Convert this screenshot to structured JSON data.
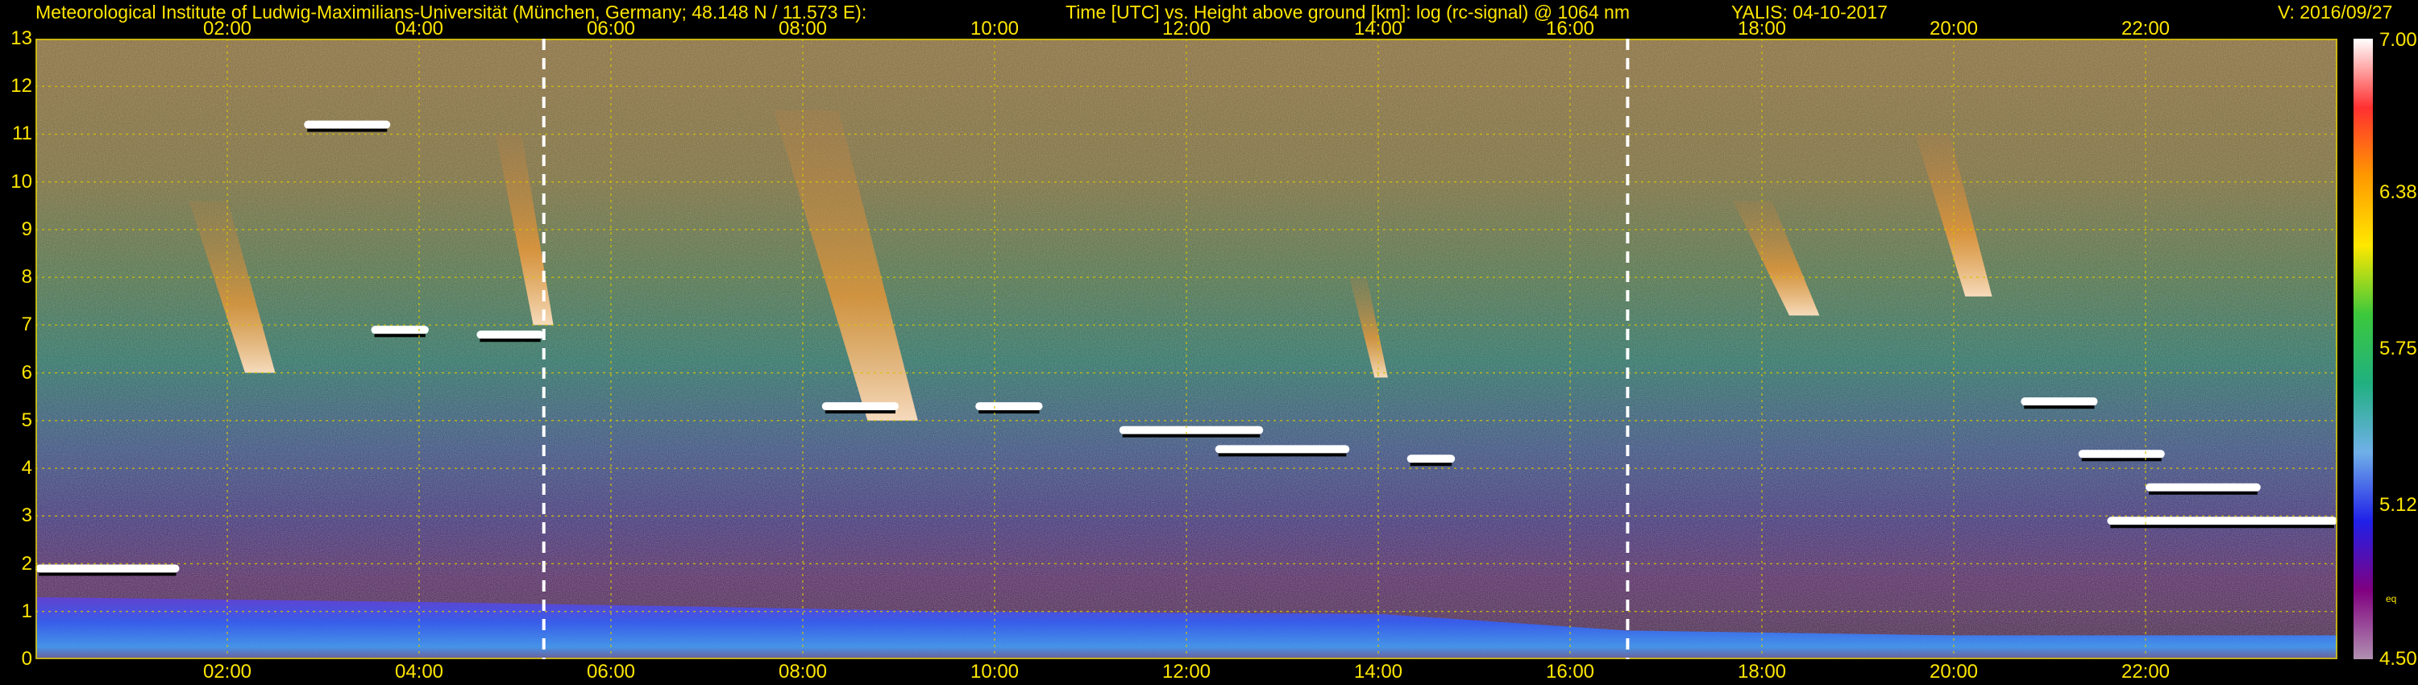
{
  "header": {
    "institute": "Meteorological Institute of Ludwig-Maximilians-Universität (München, Germany; 48.148 N / 11.573 E):",
    "plot_title": "Time [UTC] vs. Height above ground [km]: log (rc-signal) @ 1064 nm",
    "instrument": "YALIS: 04-10-2017",
    "version": "V: 2016/09/27"
  },
  "chart_data": {
    "type": "heatmap",
    "title": "Time [UTC] vs. Height above ground [km]: log (rc-signal) @ 1064 nm",
    "x_range": [
      "00:00",
      "24:00"
    ],
    "y_range": [
      0,
      13
    ],
    "y_ticks": [
      "0",
      "1",
      "2",
      "3",
      "4",
      "5",
      "6",
      "7",
      "8",
      "9",
      "10",
      "11",
      "12",
      "13"
    ],
    "x_ticks": [
      {
        "label": "02:00",
        "hour": 2
      },
      {
        "label": "04:00",
        "hour": 4
      },
      {
        "label": "06:00",
        "hour": 6
      },
      {
        "label": "08:00",
        "hour": 8
      },
      {
        "label": "10:00",
        "hour": 10
      },
      {
        "label": "12:00",
        "hour": 12
      },
      {
        "label": "14:00",
        "hour": 14
      },
      {
        "label": "16:00",
        "hour": 16
      },
      {
        "label": "18:00",
        "hour": 18
      },
      {
        "label": "20:00",
        "hour": 20
      },
      {
        "label": "22:00",
        "hour": 22
      }
    ],
    "grid": true,
    "vertical_markers_hour": [
      5.3,
      16.6
    ],
    "colorbar": {
      "min": 4.5,
      "max": 7.0,
      "tick_labels": [
        "7.00",
        "6.38",
        "5.75",
        "5.12",
        "4.50"
      ],
      "tick_values": [
        7.0,
        6.38,
        5.75,
        5.12,
        4.5
      ],
      "unit_label": "eq"
    },
    "features": {
      "cloud_segments": [
        {
          "start_hour": 0.0,
          "end_hour": 1.5,
          "height_km": 1.9
        },
        {
          "start_hour": 2.8,
          "end_hour": 3.7,
          "height_km": 11.2
        },
        {
          "start_hour": 3.5,
          "end_hour": 4.1,
          "height_km": 6.9
        },
        {
          "start_hour": 4.6,
          "end_hour": 5.3,
          "height_km": 6.8
        },
        {
          "start_hour": 8.2,
          "end_hour": 9.0,
          "height_km": 5.3
        },
        {
          "start_hour": 9.8,
          "end_hour": 10.5,
          "height_km": 5.3
        },
        {
          "start_hour": 11.3,
          "end_hour": 12.8,
          "height_km": 4.8
        },
        {
          "start_hour": 12.3,
          "end_hour": 13.7,
          "height_km": 4.4
        },
        {
          "start_hour": 14.3,
          "end_hour": 14.8,
          "height_km": 4.2
        },
        {
          "start_hour": 20.7,
          "end_hour": 21.5,
          "height_km": 5.4
        },
        {
          "start_hour": 21.3,
          "end_hour": 22.2,
          "height_km": 4.3
        },
        {
          "start_hour": 22.0,
          "end_hour": 23.2,
          "height_km": 3.6
        },
        {
          "start_hour": 21.6,
          "end_hour": 24.0,
          "height_km": 2.9
        }
      ],
      "virga_streaks": [
        {
          "start_hour": 1.6,
          "end_hour": 2.5,
          "top_km": 9.6,
          "bottom_km": 6.0
        },
        {
          "start_hour": 4.8,
          "end_hour": 5.4,
          "top_km": 11.0,
          "bottom_km": 7.0
        },
        {
          "start_hour": 7.7,
          "end_hour": 9.2,
          "top_km": 11.5,
          "bottom_km": 5.0
        },
        {
          "start_hour": 13.7,
          "end_hour": 14.1,
          "top_km": 8.0,
          "bottom_km": 5.9
        },
        {
          "start_hour": 17.7,
          "end_hour": 18.6,
          "top_km": 9.6,
          "bottom_km": 7.2
        },
        {
          "start_hour": 19.6,
          "end_hour": 20.4,
          "top_km": 11.0,
          "bottom_km": 7.6
        }
      ],
      "boundary_layer_top_km": [
        {
          "hour": 0,
          "km": 1.3
        },
        {
          "hour": 4,
          "km": 1.2
        },
        {
          "hour": 7,
          "km": 1.1
        },
        {
          "hour": 9.5,
          "km": 1.0
        },
        {
          "hour": 14,
          "km": 0.95
        },
        {
          "hour": 16.6,
          "km": 0.6
        },
        {
          "hour": 20,
          "km": 0.5
        },
        {
          "hour": 24,
          "km": 0.5
        }
      ]
    }
  },
  "colors": {
    "text": "#ffe600",
    "grid": "#d8c400",
    "background": "#000000",
    "colorbar_stops": [
      "#ffffff",
      "#ff3030",
      "#ff9a00",
      "#ffe800",
      "#3cc83c",
      "#20b080",
      "#70b0e8",
      "#2020e8",
      "#800080",
      "#b090b0"
    ]
  }
}
